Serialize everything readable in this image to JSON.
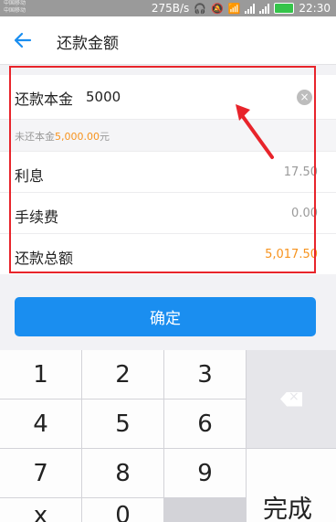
{
  "status_bar": {
    "carrier_line1": "中国移动",
    "carrier_line2": "中国移动",
    "speed": "275B/s",
    "network_label_1": "4G",
    "network_label_2": "2G",
    "battery_level": "",
    "time": "22:30"
  },
  "header": {
    "title": "还款金额"
  },
  "form": {
    "amount_label": "还款本金",
    "amount_value": "5000",
    "hint_prefix": "未还本金",
    "hint_amount": "5,000.00",
    "hint_suffix": "元",
    "interest_label": "利息",
    "interest_value": "17.50",
    "fee_label": "手续费",
    "fee_value": "0.00",
    "total_label": "还款总额",
    "total_value": "5,017.50"
  },
  "confirm_label": "确定",
  "keypad": {
    "keys": [
      "1",
      "2",
      "3",
      "4",
      "5",
      "6",
      "7",
      "8",
      "9",
      "x",
      "0"
    ],
    "done_label": "完成"
  },
  "colors": {
    "accent": "#1a8ef0",
    "highlight": "#f7931e",
    "annotation": "#e8242b"
  }
}
